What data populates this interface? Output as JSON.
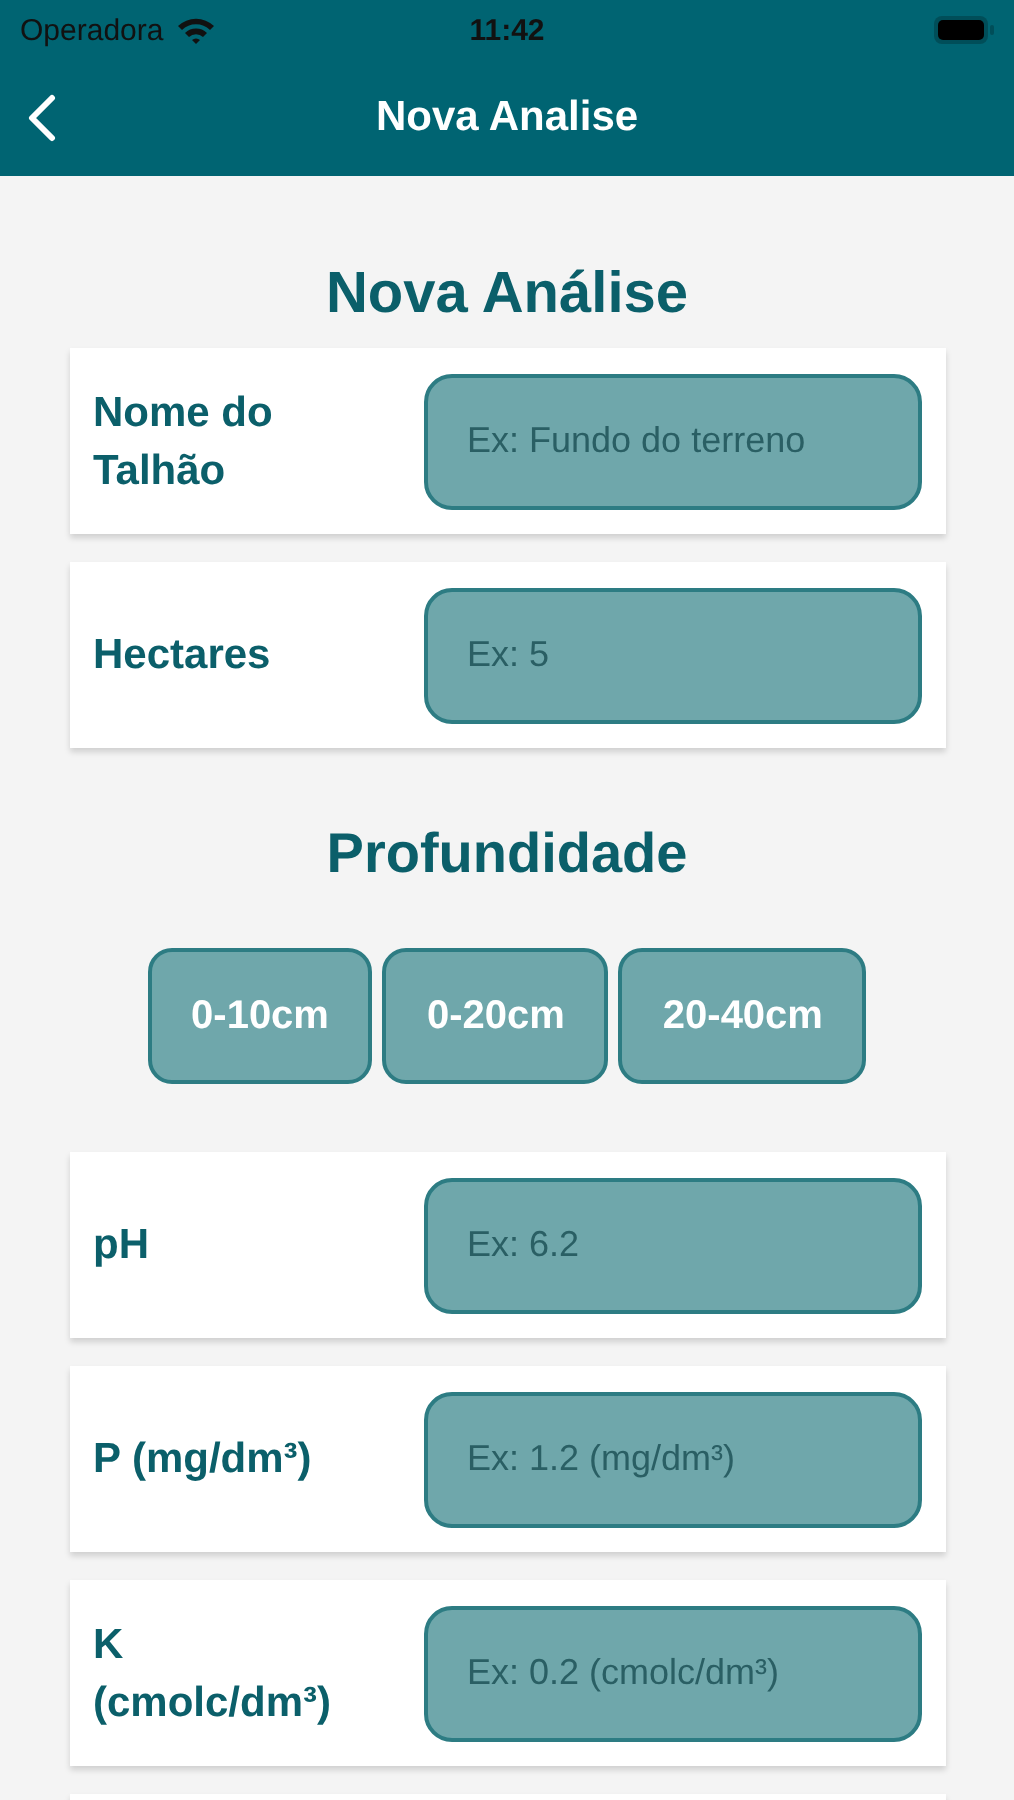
{
  "status_bar": {
    "carrier": "Operadora",
    "time": "11:42"
  },
  "nav_bar": {
    "title": "Nova Analise"
  },
  "heading": "Nova Análise",
  "fields": [
    {
      "label": "Nome do Talhão",
      "placeholder": "Ex: Fundo do terreno"
    },
    {
      "label": "Hectares",
      "placeholder": "Ex: 5"
    }
  ],
  "depth": {
    "title": "Profundidade",
    "options": [
      {
        "label": "0-10cm",
        "selected": false
      },
      {
        "label": "0-20cm",
        "selected": false
      },
      {
        "label": "20-40cm",
        "selected": false
      }
    ]
  },
  "nutrients": [
    {
      "label": "pH",
      "placeholder": "Ex: 6.2"
    },
    {
      "label": "P (mg/dm³)",
      "placeholder": "Ex: 1.2 (mg/dm³)"
    },
    {
      "label": "K (cmolc/dm³)",
      "placeholder": "Ex: 0.2 (cmolc/dm³)"
    }
  ]
}
